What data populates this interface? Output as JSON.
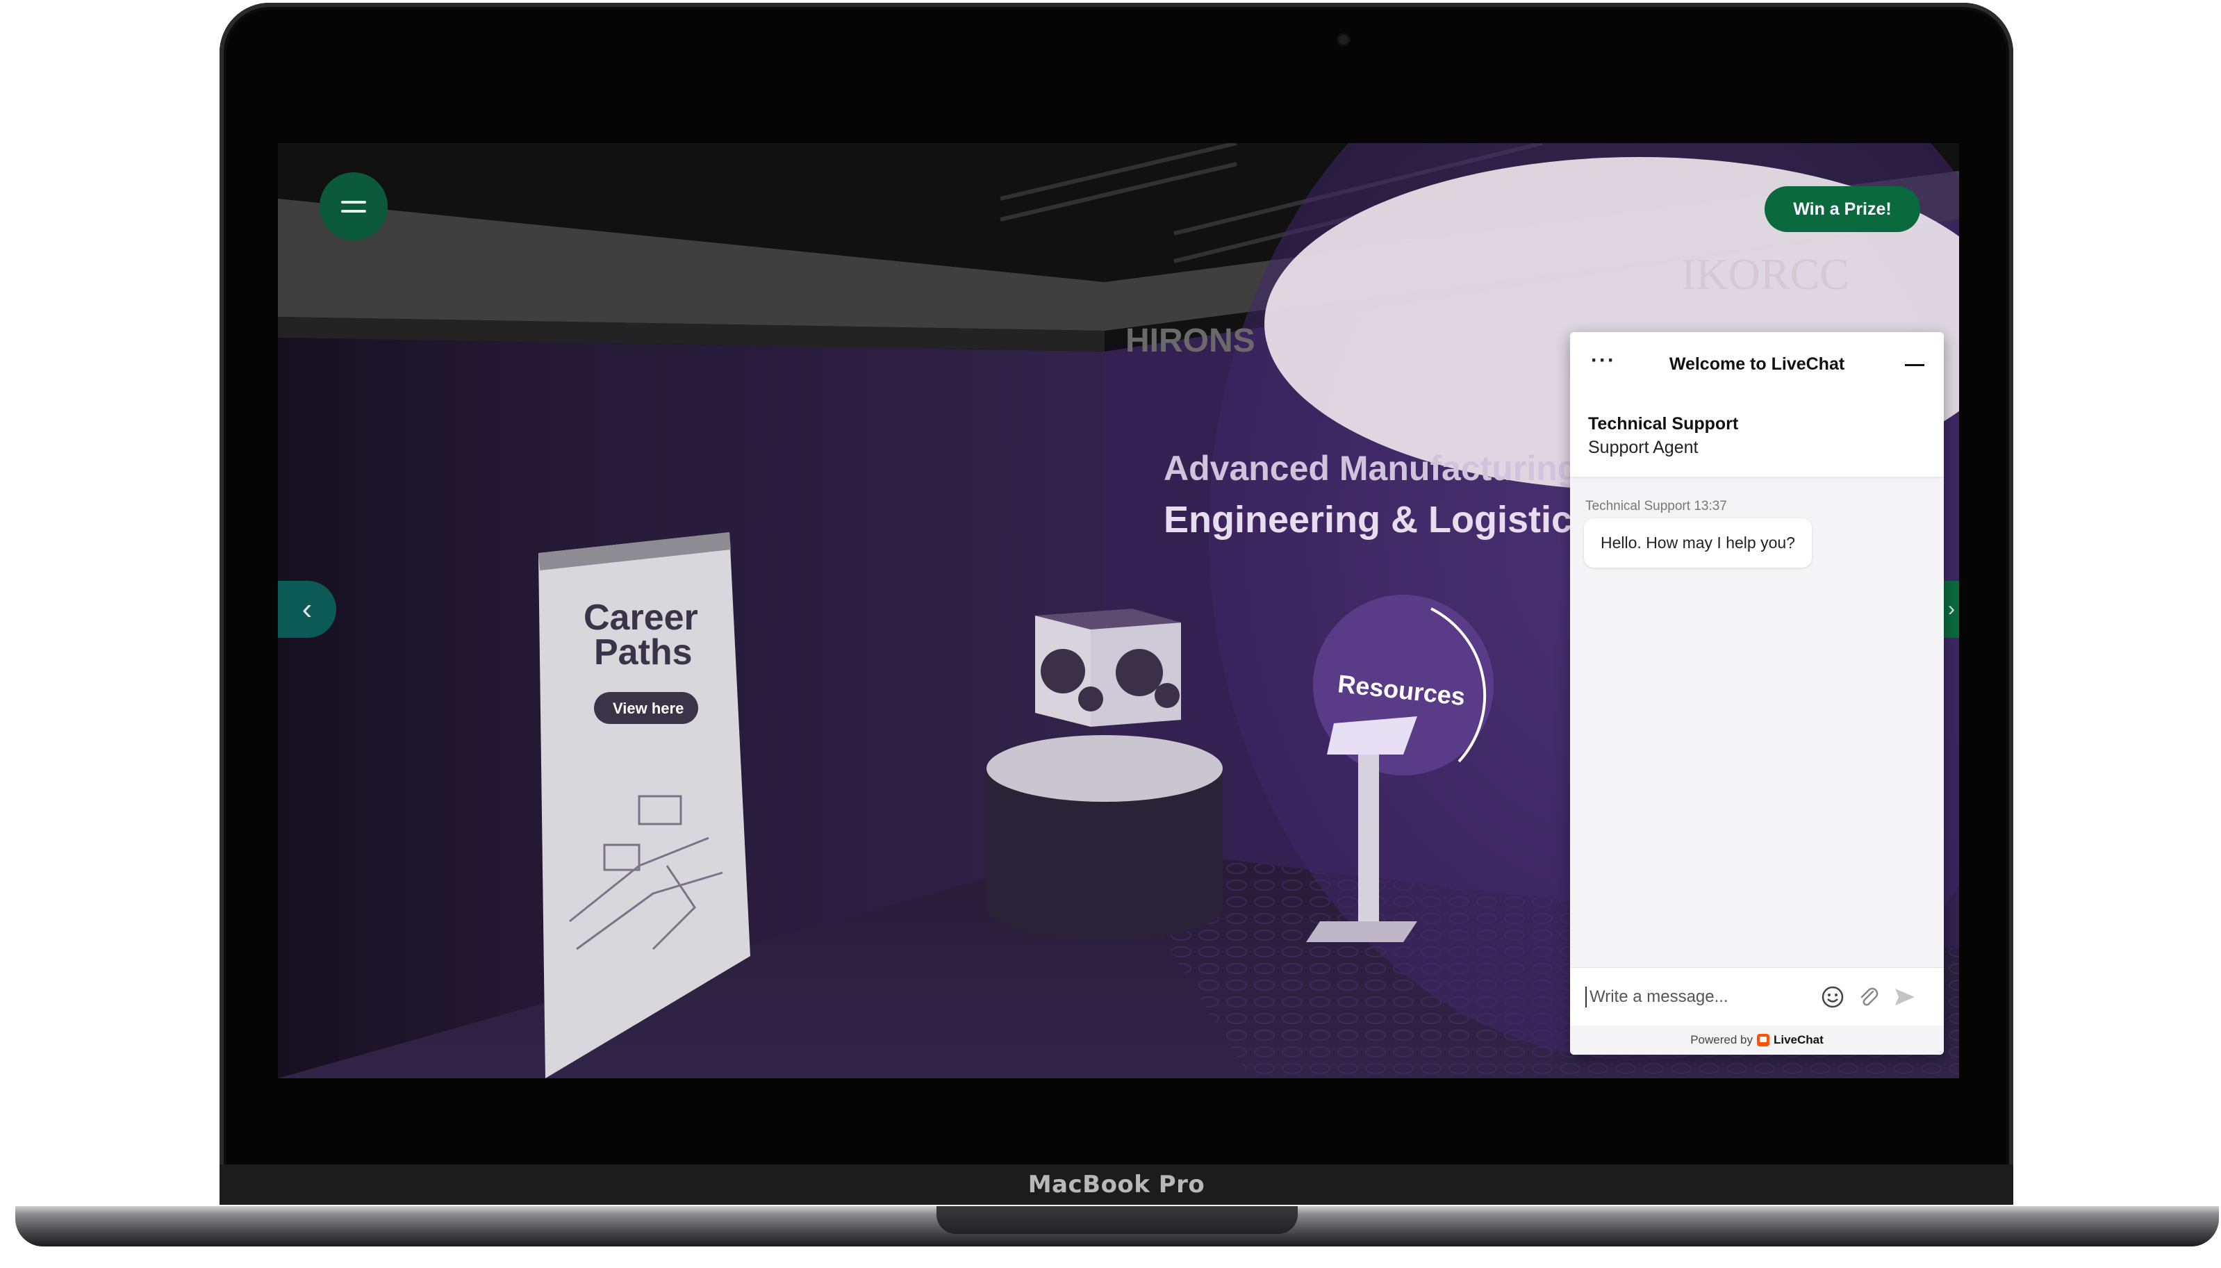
{
  "device": {
    "label": "MacBook Pro"
  },
  "booth": {
    "headline_line1": "Advanced Manufacturing",
    "headline_line2": "Engineering & Logistics",
    "banner_title_line1": "Career",
    "banner_title_line2": "Paths",
    "banner_button": "View here",
    "resources_label": "Resources",
    "sponsors": [
      "HIRONS",
      "IKORCC"
    ]
  },
  "toolbar": {
    "prize_button": "Win a Prize!"
  },
  "chat": {
    "title": "Welcome to LiveChat",
    "agent_name": "Technical Support",
    "agent_role": "Support Agent",
    "message_meta": "Technical Support 13:37",
    "message_text": "Hello. How may I help you?",
    "input_placeholder": "Write a message...",
    "powered_prefix": "Powered by",
    "powered_brand": "LiveChat",
    "brand_color": "#ff5100"
  },
  "colors": {
    "accent_green": "#0b6a3d",
    "booth_purple": "#4a2a72"
  }
}
